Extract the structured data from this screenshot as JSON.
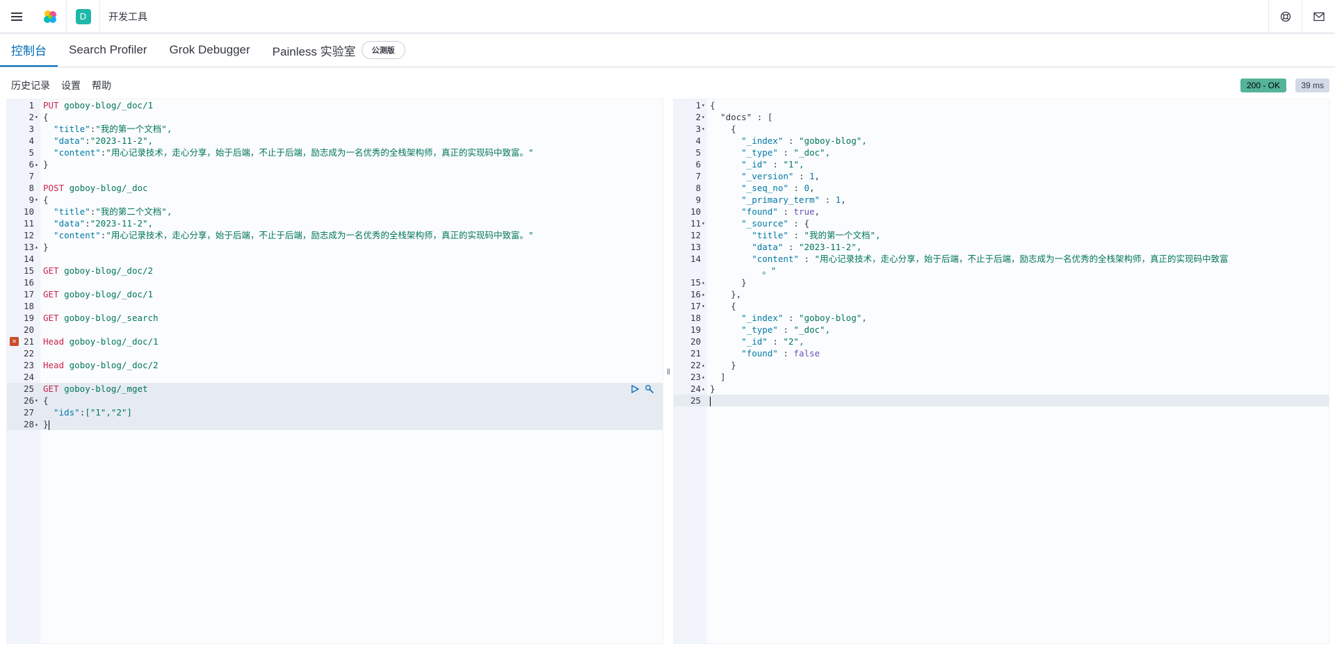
{
  "header": {
    "menu_icon": "hamburger-icon",
    "logo_icon": "elastic-logo-icon",
    "space_letter": "D",
    "breadcrumb": "开发工具",
    "help_icon": "lifebuoy-icon",
    "mail_icon": "mail-icon"
  },
  "tabs": [
    {
      "label": "控制台"
    },
    {
      "label": "Search Profiler"
    },
    {
      "label": "Grok Debugger"
    },
    {
      "label": "Painless 实验室"
    }
  ],
  "beta_badge": "公测版",
  "subnav": {
    "history": "历史记录",
    "settings": "设置",
    "help": "帮助"
  },
  "status": {
    "code": "200 - OK",
    "time": "39 ms"
  },
  "colors": {
    "accent": "#006bb8",
    "ok": "#54b399",
    "error": "#cc4c2a"
  },
  "request": {
    "lines": [
      {
        "n": "1",
        "fold": "",
        "method": "PUT",
        "rest": "goboy-blog/_doc/1"
      },
      {
        "n": "2",
        "fold": "▾",
        "text": "{"
      },
      {
        "n": "3",
        "fold": "",
        "key": "  \"title\"",
        "sep": ":",
        "val": "\"我的第一个文档\","
      },
      {
        "n": "4",
        "fold": "",
        "key": "  \"data\"",
        "sep": ":",
        "val": "\"2023-11-2\","
      },
      {
        "n": "5",
        "fold": "",
        "key": "  \"content\"",
        "sep": ":",
        "val": "\"用心记录技术，走心分享，始于后端，不止于后端，励志成为一名优秀的全栈架构师，真正的实现码中致富。\""
      },
      {
        "n": "6",
        "fold": "▴",
        "text": "}"
      },
      {
        "n": "7",
        "fold": "",
        "text": ""
      },
      {
        "n": "8",
        "fold": "",
        "method": "POST",
        "rest": "goboy-blog/_doc"
      },
      {
        "n": "9",
        "fold": "▾",
        "text": "{"
      },
      {
        "n": "10",
        "fold": "",
        "key": "  \"title\"",
        "sep": ":",
        "val": "\"我的第二个文档\","
      },
      {
        "n": "11",
        "fold": "",
        "key": "  \"data\"",
        "sep": ":",
        "val": "\"2023-11-2\","
      },
      {
        "n": "12",
        "fold": "",
        "key": "  \"content\"",
        "sep": ":",
        "val": "\"用心记录技术，走心分享，始于后端，不止于后端，励志成为一名优秀的全栈架构师，真正的实现码中致富。\""
      },
      {
        "n": "13",
        "fold": "▴",
        "text": "}"
      },
      {
        "n": "14",
        "fold": "",
        "text": ""
      },
      {
        "n": "15",
        "fold": "",
        "method": "GET",
        "rest": "goboy-blog/_doc/2"
      },
      {
        "n": "16",
        "fold": "",
        "text": ""
      },
      {
        "n": "17",
        "fold": "",
        "method": "GET",
        "rest": "goboy-blog/_doc/1"
      },
      {
        "n": "18",
        "fold": "",
        "text": ""
      },
      {
        "n": "19",
        "fold": "",
        "method": "GET",
        "rest": "goboy-blog/_search"
      },
      {
        "n": "20",
        "fold": "",
        "text": ""
      },
      {
        "n": "21",
        "fold": "",
        "method": "Head",
        "rest": "goboy-blog/_doc/1",
        "error": "✕"
      },
      {
        "n": "22",
        "fold": "",
        "text": ""
      },
      {
        "n": "23",
        "fold": "",
        "method": "Head",
        "rest": "goboy-blog/_doc/2"
      },
      {
        "n": "24",
        "fold": "",
        "text": ""
      },
      {
        "n": "25",
        "fold": "",
        "method": "GET",
        "rest": "goboy-blog/_mget",
        "hl": true,
        "actions": true
      },
      {
        "n": "26",
        "fold": "▾",
        "text": "{",
        "hl": true
      },
      {
        "n": "27",
        "fold": "",
        "key": "  \"ids\"",
        "sep": ":",
        "val": "[\"1\",\"2\"]",
        "hl": true
      },
      {
        "n": "28",
        "fold": "▴",
        "text": "}",
        "hl": true,
        "cursor": true
      }
    ],
    "run_icon": "play-icon",
    "wrench_icon": "wrench-icon"
  },
  "response": {
    "lines": [
      {
        "n": "1",
        "fold": "▾",
        "text": "{"
      },
      {
        "n": "2",
        "fold": "▾",
        "text": "  \"docs\" : ["
      },
      {
        "n": "3",
        "fold": "▾",
        "text": "    {"
      },
      {
        "n": "4",
        "fold": "",
        "key": "      \"_index\"",
        "val": "\"goboy-blog\","
      },
      {
        "n": "5",
        "fold": "",
        "key": "      \"_type\"",
        "val": "\"_doc\","
      },
      {
        "n": "6",
        "fold": "",
        "key": "      \"_id\"",
        "val": "\"1\","
      },
      {
        "n": "7",
        "fold": "",
        "key": "      \"_version\"",
        "num": "1",
        "tail": ","
      },
      {
        "n": "8",
        "fold": "",
        "key": "      \"_seq_no\"",
        "num": "0",
        "tail": ","
      },
      {
        "n": "9",
        "fold": "",
        "key": "      \"_primary_term\"",
        "num": "1",
        "tail": ","
      },
      {
        "n": "10",
        "fold": "",
        "key": "      \"found\"",
        "bool": "true",
        "tail": ","
      },
      {
        "n": "11",
        "fold": "▾",
        "key": "      \"_source\"",
        "tailtext": " : {"
      },
      {
        "n": "12",
        "fold": "",
        "key": "        \"title\"",
        "val": "\"我的第一个文档\","
      },
      {
        "n": "13",
        "fold": "",
        "key": "        \"data\"",
        "val": "\"2023-11-2\","
      },
      {
        "n": "14",
        "fold": "",
        "key": "        \"content\"",
        "val": "\"用心记录技术，走心分享，始于后端，不止于后端，励志成为一名优秀的全栈架构师，真正的实现码中致富"
      },
      {
        "n": "",
        "fold": "",
        "val2": "          。\""
      },
      {
        "n": "15",
        "fold": "▴",
        "text": "      }"
      },
      {
        "n": "16",
        "fold": "▴",
        "text": "    },"
      },
      {
        "n": "17",
        "fold": "▾",
        "text": "    {"
      },
      {
        "n": "18",
        "fold": "",
        "key": "      \"_index\"",
        "val": "\"goboy-blog\","
      },
      {
        "n": "19",
        "fold": "",
        "key": "      \"_type\"",
        "val": "\"_doc\","
      },
      {
        "n": "20",
        "fold": "",
        "key": "      \"_id\"",
        "val": "\"2\","
      },
      {
        "n": "21",
        "fold": "",
        "key": "      \"found\"",
        "bool": "false",
        "tail": ""
      },
      {
        "n": "22",
        "fold": "▴",
        "text": "    }"
      },
      {
        "n": "23",
        "fold": "▴",
        "text": "  ]"
      },
      {
        "n": "24",
        "fold": "▴",
        "text": "}"
      },
      {
        "n": "25",
        "fold": "",
        "text": "",
        "hl": true,
        "cursor": true
      }
    ]
  },
  "divider_glyph": "‖"
}
